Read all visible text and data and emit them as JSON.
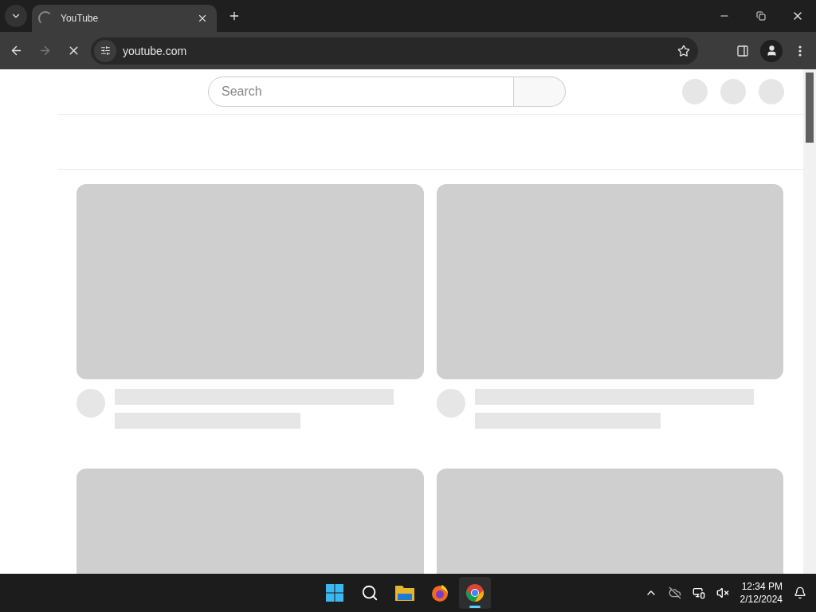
{
  "tab": {
    "title": "YouTube",
    "loading": true
  },
  "address_bar": {
    "url": "youtube.com"
  },
  "page": {
    "search": {
      "placeholder": "Search"
    }
  },
  "taskbar": {
    "apps": [
      {
        "kind": "start",
        "selected": false
      },
      {
        "kind": "search",
        "selected": false
      },
      {
        "kind": "files",
        "selected": false
      },
      {
        "kind": "firefox",
        "selected": false
      },
      {
        "kind": "chrome",
        "selected": true
      }
    ],
    "clock": {
      "time": "12:34 PM",
      "date": "2/12/2024"
    }
  }
}
